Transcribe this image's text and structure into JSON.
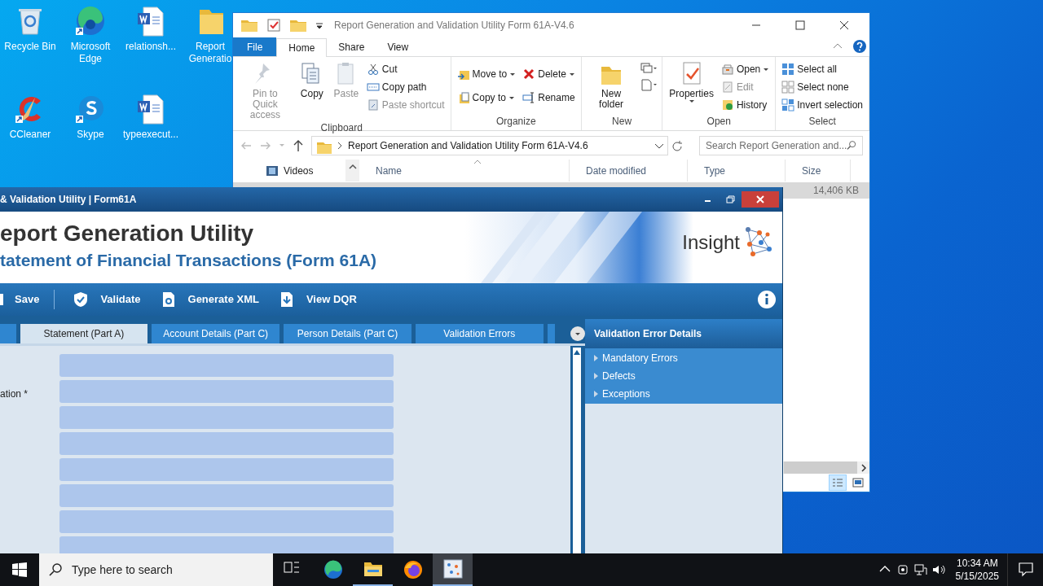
{
  "desktop_icons": [
    {
      "label": "Recycle Bin"
    },
    {
      "label": "Microsoft Edge"
    },
    {
      "label": "relationsh..."
    },
    {
      "label": "Report Generatio"
    },
    {
      "label": "CCleaner"
    },
    {
      "label": "Skype"
    },
    {
      "label": "typeexecut..."
    }
  ],
  "explorer": {
    "title": "Report Generation and Validation Utility Form 61A-V4.6",
    "ribbon_tabs": [
      {
        "label": "File",
        "kind": "file",
        "selected": false
      },
      {
        "label": "Home",
        "kind": "tab",
        "selected": true
      },
      {
        "label": "Share",
        "kind": "tab",
        "selected": false
      },
      {
        "label": "View",
        "kind": "tab",
        "selected": false
      }
    ],
    "ribbon_groups": [
      {
        "label": "Clipboard",
        "items": [
          {
            "label": "Pin to Quick access",
            "kind": "large",
            "disabled": true,
            "dropdown": false
          },
          {
            "label": "Copy",
            "kind": "large",
            "disabled": false,
            "dropdown": false
          },
          {
            "label": "Paste",
            "kind": "large",
            "disabled": true,
            "dropdown": false
          },
          {
            "label": "Cut",
            "kind": "small",
            "disabled": false,
            "dropdown": false
          },
          {
            "label": "Copy path",
            "kind": "small",
            "disabled": false,
            "dropdown": false
          },
          {
            "label": "Paste shortcut",
            "kind": "small",
            "disabled": true,
            "dropdown": false
          }
        ]
      },
      {
        "label": "Organize",
        "items": [
          {
            "label": "Move to",
            "kind": "medium",
            "disabled": false,
            "dropdown": true
          },
          {
            "label": "Copy to",
            "kind": "medium",
            "disabled": false,
            "dropdown": true
          },
          {
            "label": "Delete",
            "kind": "medium",
            "disabled": false,
            "dropdown": true
          },
          {
            "label": "Rename",
            "kind": "medium",
            "disabled": false,
            "dropdown": false
          }
        ]
      },
      {
        "label": "New",
        "items": [
          {
            "label": "New folder",
            "kind": "large",
            "disabled": false,
            "dropdown": false
          }
        ]
      },
      {
        "label": "Open",
        "items": [
          {
            "label": "Properties",
            "kind": "large",
            "disabled": false,
            "dropdown": true
          },
          {
            "label": "Open",
            "kind": "small",
            "disabled": false,
            "dropdown": true
          },
          {
            "label": "Edit",
            "kind": "small",
            "disabled": true,
            "dropdown": false
          },
          {
            "label": "History",
            "kind": "small",
            "disabled": false,
            "dropdown": false
          }
        ]
      },
      {
        "label": "Select",
        "items": [
          {
            "label": "Select all",
            "kind": "small",
            "disabled": false,
            "dropdown": false
          },
          {
            "label": "Select none",
            "kind": "small",
            "disabled": false,
            "dropdown": false
          },
          {
            "label": "Invert selection",
            "kind": "small",
            "disabled": false,
            "dropdown": false
          }
        ]
      }
    ],
    "address": "Report Generation and Validation Utility Form 61A-V4.6",
    "search_placeholder": "Search Report Generation and...",
    "nav_items": [
      {
        "label": "Videos"
      }
    ],
    "columns": [
      "Name",
      "Date modified",
      "Type",
      "Size"
    ],
    "file_size": "14,406 KB"
  },
  "app": {
    "title": "& Validation Utility | Form61A",
    "heading": "eport Generation Utility",
    "subheading": "tatement of Financial Transactions (Form 61A)",
    "brand": "Insight",
    "toolbar": [
      "Save",
      "Validate",
      "Generate XML",
      "View DQR"
    ],
    "tabs": [
      {
        "label": "Statement (Part A)",
        "selected": true
      },
      {
        "label": "Account Details (Part C)",
        "selected": false
      },
      {
        "label": "Person Details (Part C)",
        "selected": false
      },
      {
        "label": "Validation Errors",
        "selected": false
      }
    ],
    "form_label": "ation *",
    "fields": [
      {
        "kind": "text"
      },
      {
        "kind": "text"
      },
      {
        "kind": "text"
      },
      {
        "kind": "text"
      },
      {
        "kind": "text"
      },
      {
        "kind": "text"
      },
      {
        "kind": "text"
      },
      {
        "kind": "text"
      }
    ],
    "panel": {
      "title": "Validation Error Details",
      "items": [
        {
          "label": "Mandatory Errors",
          "expanded": false
        },
        {
          "label": "Defects",
          "expanded": false
        },
        {
          "label": "Exceptions",
          "expanded": false
        }
      ]
    }
  },
  "taskbar": {
    "search_placeholder": "Type here to search",
    "apps": [
      {
        "kind": "taskview",
        "active": false
      },
      {
        "kind": "edge",
        "active": false
      },
      {
        "kind": "explorer",
        "active": true
      },
      {
        "kind": "firefox",
        "active": false
      },
      {
        "kind": "utility",
        "active": true
      }
    ],
    "time": "10:34 AM",
    "date": "5/15/2025"
  }
}
